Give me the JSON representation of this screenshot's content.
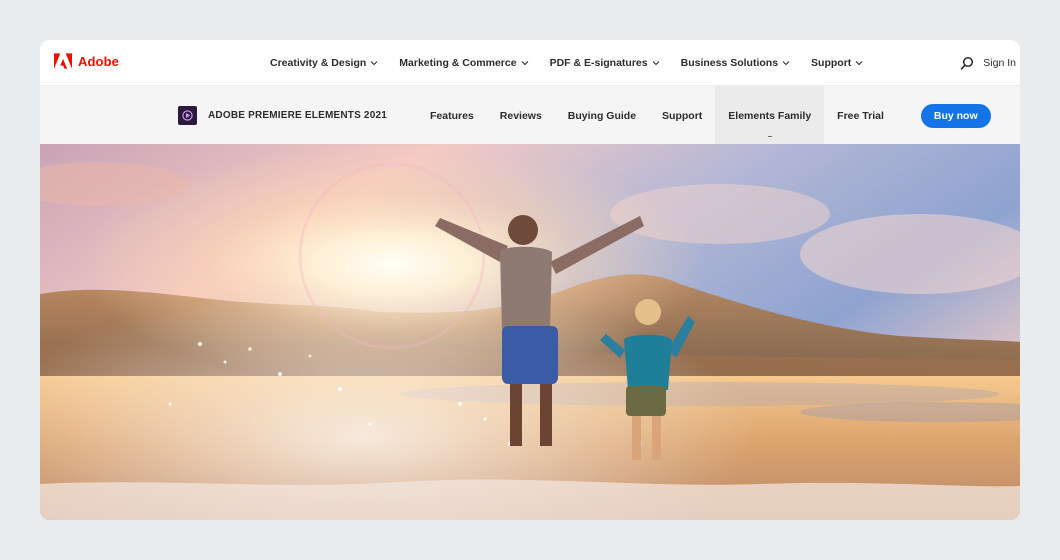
{
  "global_nav": {
    "brand": "Adobe",
    "menu": [
      {
        "label": "Creativity & Design"
      },
      {
        "label": "Marketing & Commerce"
      },
      {
        "label": "PDF & E-signatures"
      },
      {
        "label": "Business Solutions"
      },
      {
        "label": "Support"
      }
    ],
    "sign_in": "Sign In",
    "search_icon": "search-icon",
    "brand_color": "#eb1000"
  },
  "product_nav": {
    "product_name": "ADOBE PREMIERE ELEMENTS 2021",
    "product_icon": "premiere-elements-icon",
    "links": [
      {
        "label": "Features"
      },
      {
        "label": "Reviews"
      },
      {
        "label": "Buying Guide"
      },
      {
        "label": "Support"
      },
      {
        "label": "Elements Family",
        "active": true
      },
      {
        "label": "Free Trial"
      }
    ],
    "cta": "Buy now",
    "cta_color": "#1473e6"
  },
  "hero": {
    "image": "children-jumping-on-beach-at-sunset"
  }
}
